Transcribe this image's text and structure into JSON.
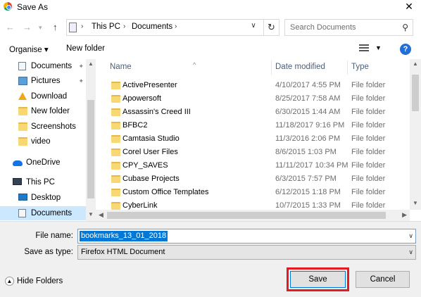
{
  "window": {
    "title": "Save As",
    "close_glyph": "✕"
  },
  "address": {
    "crumbs": [
      "This PC",
      "Documents"
    ],
    "search_placeholder": "Search Documents"
  },
  "toolbar": {
    "organise": "Organise ▾",
    "new_folder": "New folder",
    "help": "?"
  },
  "nav": {
    "items": [
      {
        "label": "Documents",
        "icon": "documents-icon",
        "pinned": true
      },
      {
        "label": "Pictures",
        "icon": "pictures-icon",
        "pinned": true
      },
      {
        "label": "Download",
        "icon": "download-icon",
        "pinned": false
      },
      {
        "label": "New folder",
        "icon": "folder-icon",
        "pinned": false
      },
      {
        "label": "Screenshots",
        "icon": "folder-icon",
        "pinned": false
      },
      {
        "label": "video",
        "icon": "folder-icon",
        "pinned": false
      },
      {
        "label": "OneDrive",
        "icon": "onedrive-icon",
        "pinned": false
      },
      {
        "label": "This PC",
        "icon": "this-pc-icon",
        "pinned": false
      },
      {
        "label": "Desktop",
        "icon": "desktop-icon",
        "pinned": false
      },
      {
        "label": "Documents",
        "icon": "documents-icon",
        "pinned": false,
        "selected": true
      }
    ]
  },
  "filelist": {
    "columns": [
      "Name",
      "Date modified",
      "Type"
    ],
    "rows": [
      {
        "name": "ActivePresenter",
        "date": "4/10/2017 4:55 PM",
        "type": "File folder"
      },
      {
        "name": "Apowersoft",
        "date": "8/25/2017 7:58 AM",
        "type": "File folder"
      },
      {
        "name": "Assassin's Creed III",
        "date": "6/30/2015 1:44 AM",
        "type": "File folder"
      },
      {
        "name": "BFBC2",
        "date": "11/18/2017 9:16 PM",
        "type": "File folder"
      },
      {
        "name": "Camtasia Studio",
        "date": "11/3/2016 2:06 PM",
        "type": "File folder"
      },
      {
        "name": "Corel User Files",
        "date": "8/6/2015 1:03 PM",
        "type": "File folder"
      },
      {
        "name": "CPY_SAVES",
        "date": "11/11/2017 10:34 PM",
        "type": "File folder"
      },
      {
        "name": "Cubase Projects",
        "date": "6/3/2015 7:57 PM",
        "type": "File folder"
      },
      {
        "name": "Custom Office Templates",
        "date": "6/12/2015 1:18 PM",
        "type": "File folder"
      },
      {
        "name": "CyberLink",
        "date": "10/7/2015 1:33 PM",
        "type": "File folder"
      }
    ]
  },
  "form": {
    "file_name_label": "File name:",
    "file_name_value": "bookmarks_13_01_2018",
    "save_type_label": "Save as type:",
    "save_type_value": "Firefox HTML Document"
  },
  "footer": {
    "hide_folders": "Hide Folders",
    "save": "Save",
    "cancel": "Cancel"
  },
  "colors": {
    "accent": "#0078d7",
    "highlight_box": "#e31b23",
    "selection": "#cce8ff"
  }
}
